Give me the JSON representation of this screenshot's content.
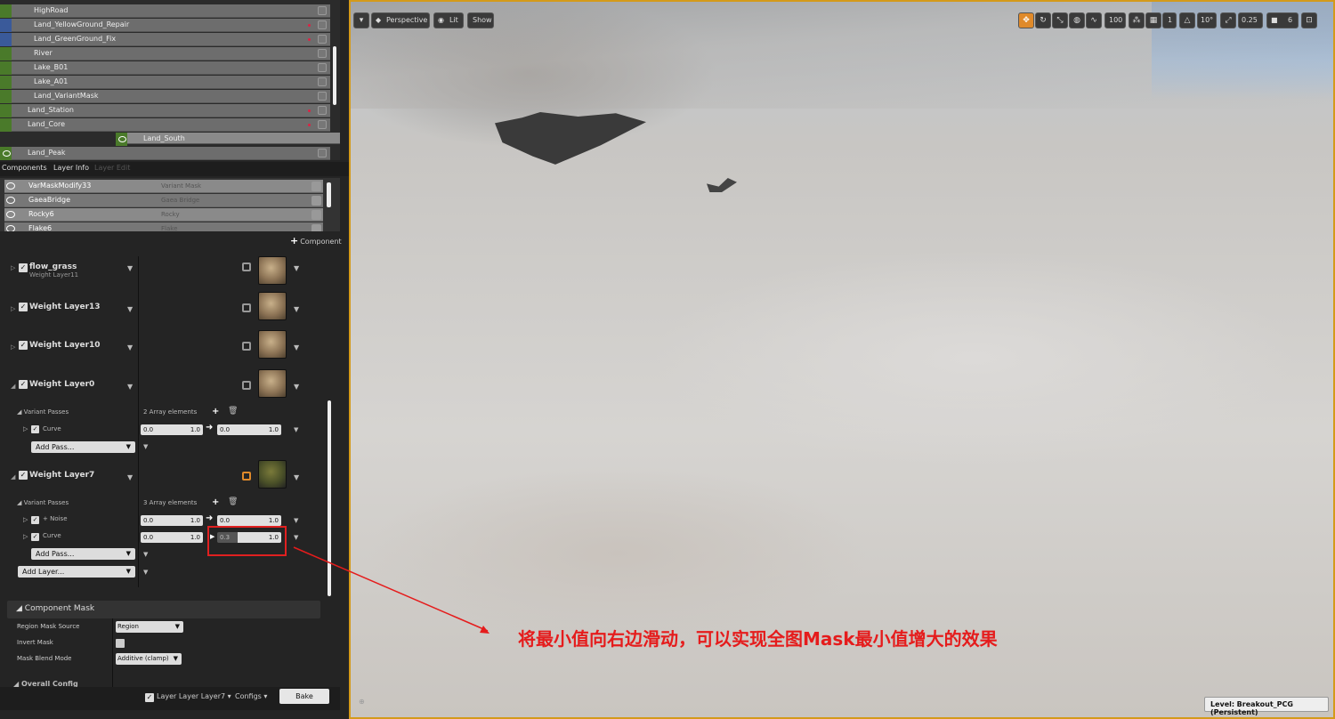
{
  "outliner": {
    "items": [
      {
        "label": "HighRoad",
        "vis": "green",
        "dot": false
      },
      {
        "label": "Land_YellowGround_Repair",
        "vis": "blue",
        "dot": true
      },
      {
        "label": "Land_GreenGround_Fix",
        "vis": "blue",
        "dot": true
      },
      {
        "label": "River",
        "vis": "green",
        "dot": false
      },
      {
        "label": "Lake_B01",
        "vis": "green",
        "dot": false
      },
      {
        "label": "Lake_A01",
        "vis": "green",
        "dot": false
      },
      {
        "label": "Land_VariantMask",
        "vis": "green",
        "dot": false
      },
      {
        "label": "Land_Station",
        "vis": "green",
        "dot": true
      },
      {
        "label": "Land_Core",
        "vis": "green",
        "dot": true
      },
      {
        "label": "Land_South",
        "vis": "green-eye",
        "dot": true
      },
      {
        "label": "Land_Peak",
        "vis": "green-eye",
        "dot": false
      }
    ]
  },
  "tabs": {
    "components": "Components",
    "layer_info": "Layer Info",
    "layer_edit": "Layer Edit"
  },
  "component_list": [
    {
      "name": "VarMaskModify33",
      "type": "Variant Mask"
    },
    {
      "name": "GaeaBridge",
      "type": "Gaea Bridge"
    },
    {
      "name": "Rocky6",
      "type": "Rocky"
    },
    {
      "name": "Flake6",
      "type": "Flake"
    }
  ],
  "add_component": "Component",
  "layers": [
    {
      "name": "flow_grass",
      "sub": "Weight Layer11"
    },
    {
      "name": "Weight Layer13",
      "sub": ""
    },
    {
      "name": "Weight Layer10",
      "sub": ""
    },
    {
      "name": "Weight Layer0",
      "sub": ""
    },
    {
      "name": "Weight Layer7",
      "sub": ""
    }
  ],
  "variant_passes": {
    "label": "Variant Passes",
    "layer0_count": "2 Array elements",
    "layer7_count": "3 Array elements",
    "curve": "Curve",
    "noise": "+ Noise",
    "add_pass": "Add Pass..."
  },
  "ranges": {
    "l0_curve": {
      "in_min": "0.0",
      "in_max": "1.0",
      "out_min": "0.0",
      "out_max": "1.0"
    },
    "l7_noise": {
      "in_min": "0.0",
      "in_max": "1.0",
      "out_min": "0.0",
      "out_max": "1.0"
    },
    "l7_curve": {
      "in_min": "0.0",
      "in_max": "1.0",
      "out_min": "0.3",
      "out_max": "1.0"
    }
  },
  "add_layer": "Add Layer...",
  "component_mask": {
    "title": "Component Mask",
    "region_label": "Region Mask Source",
    "region_value": "Region",
    "invert_label": "Invert Mask",
    "blend_label": "Mask Blend Mode",
    "blend_value": "Additive (clamp)"
  },
  "overall_config": "Overall Config",
  "bottom": {
    "layer": "Layer Layer Layer7",
    "configs": "Configs",
    "bake": "Bake"
  },
  "viewport": {
    "perspective": "Perspective",
    "lit": "Lit",
    "show": "Show",
    "speed": "100",
    "grid": "1",
    "angle": "10°",
    "scale": "0.25",
    "cam": "6",
    "level_label": "Level:",
    "level_value": "Breakout_PCG (Persistent)"
  },
  "annotation": "将最小值向右边滑动，可以实现全图Mask最小值增大的效果",
  "colors": {
    "accent_border": "#d49a1a",
    "annotation": "#e51c1c"
  }
}
